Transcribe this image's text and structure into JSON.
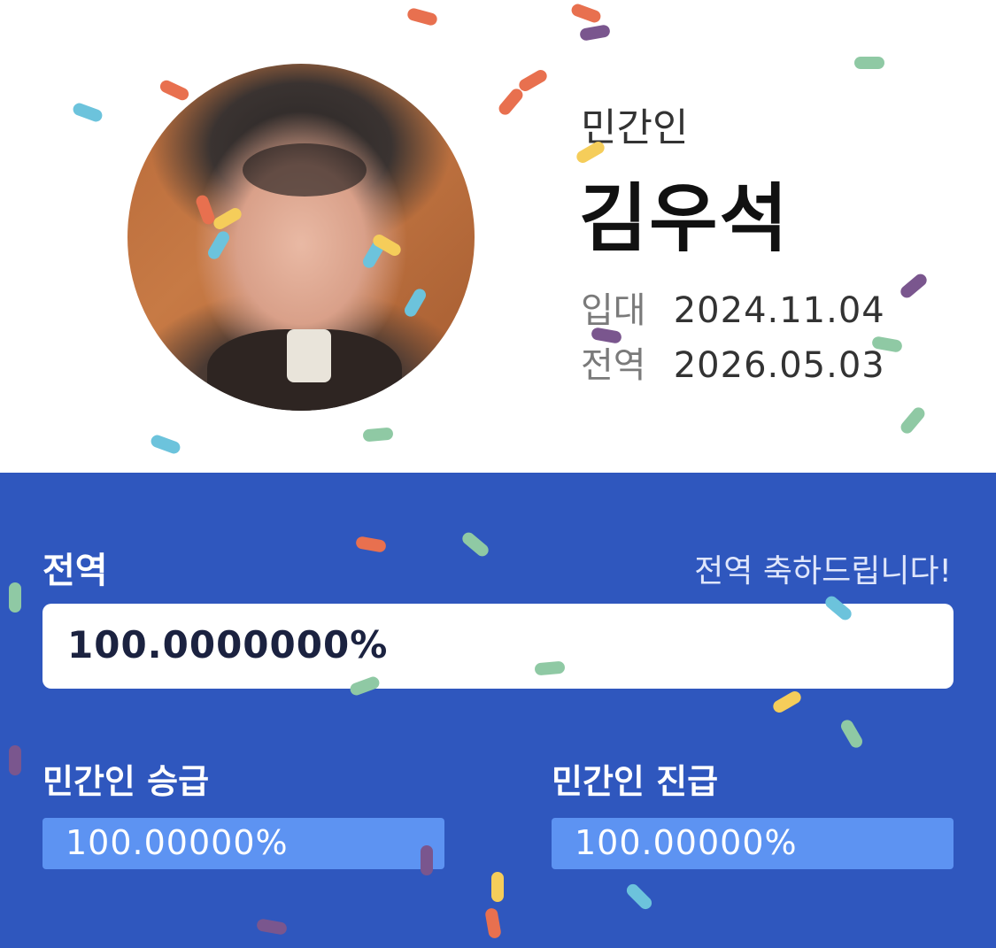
{
  "profile": {
    "category": "민간인",
    "name": "김우석",
    "enlist_label": "입대",
    "enlist_date": "2024.11.04",
    "discharge_label": "전역",
    "discharge_date": "2026.05.03",
    "avatar": "profile-photo"
  },
  "discharge": {
    "title": "전역",
    "message": "전역 축하드립니다!",
    "percent": "100.0000000%",
    "progress": 1.0
  },
  "promotion": {
    "label": "민간인 승급",
    "percent": "100.00000%",
    "progress": 1.0
  },
  "advancement": {
    "label": "민간인 진급",
    "percent": "100.00000%",
    "progress": 1.0
  },
  "colors": {
    "header_bg": "#ffffff",
    "panel_bg": "#2f57be",
    "bar_fill": "#5d93f2",
    "confetti": [
      "#e8704f",
      "#6cc3dc",
      "#f5cd5a",
      "#8fc9a4",
      "#7a568e"
    ]
  }
}
